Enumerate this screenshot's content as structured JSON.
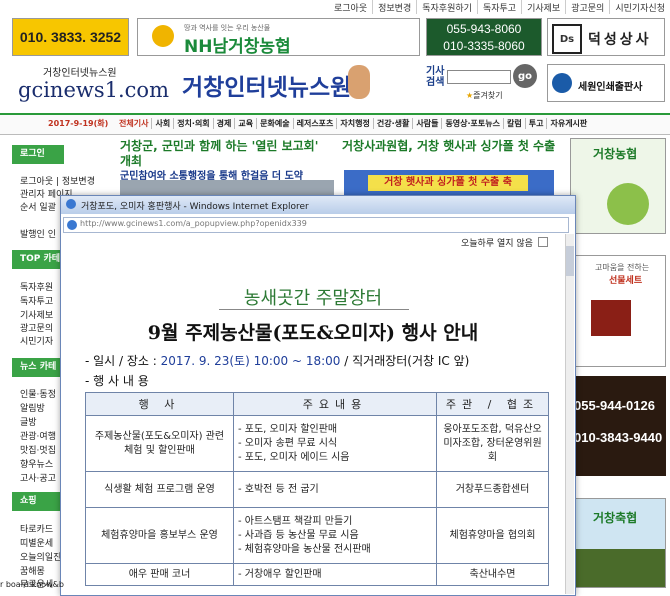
{
  "top_nav": [
    "로그아웃",
    "정보변경",
    "독자후원하기",
    "독자투고",
    "기사제보",
    "광고문의",
    "시민기자신청"
  ],
  "ads": {
    "phone_yellow": "010. 3833. 3252",
    "nh_slogan": "땅과 역사를 잇는 우리 농산물",
    "nh_name": "NH남거창농협",
    "phones_green": [
      "055-943-8060",
      "010-3335-8060"
    ],
    "ds_logo": "Ds",
    "ds_name": "덕성상사",
    "seweon": "세원인쇄출판사"
  },
  "site": {
    "small_name": "거창인터넷뉴스원",
    "domain": "gcinews1.com",
    "big_title": "거창인터넷뉴스원"
  },
  "search": {
    "label1": "기사",
    "label2": "검색",
    "go": "go",
    "favorites": "즐겨찾기"
  },
  "menu": {
    "date": "2017-9-19(화)",
    "items": [
      "전체기사",
      "사회",
      "정치·의회",
      "경제",
      "교육",
      "문화예술",
      "레저스포츠",
      "자치행정",
      "건강·생활",
      "사람들",
      "동영상·포토뉴스",
      "칼럼",
      "투고",
      "자유게시판"
    ]
  },
  "sidebar": {
    "login_head": "로그인",
    "login_items": [
      "로그아웃 | 정보변경",
      "관리자 페이지",
      "순서 일괄"
    ],
    "extra_item": "발행인 인",
    "top_head": "TOP 카테",
    "top_items": [
      "독자후원",
      "독자투고",
      "기사제보",
      "광고문의",
      "시민기자"
    ],
    "news_head": "뉴스 카테",
    "news_items": [
      "인물·동정",
      "알림방",
      "글방",
      "관광·여행",
      "맛집·멋집",
      "향우뉴스",
      "고사·공고"
    ],
    "shop_head": "쇼핑",
    "shop_items": [
      "타로카드",
      "띠별운세",
      "오늘의일진",
      "꿈해몽",
      "무료운세"
    ]
  },
  "articles": {
    "a1_title": "거창군, 군민과 함께 하는 '열린 보고회' 개최",
    "a1_sub": "군민참여와 소통행정을 통해 한걸음 더 도약",
    "a2_title": "거창사과원협, 거창 햇사과 싱가폴 첫 수출",
    "a2_banner": "거창 햇사과 싱가폴 첫 수출 축"
  },
  "right_ads": {
    "nonghyup": "거창농협",
    "gift1": "고마움을 전하는",
    "gift2": "선물세트",
    "phone1": "055-944-0126",
    "phone2": "010-3843-9440",
    "festival": "거창축협"
  },
  "popup": {
    "window_title": "거창포도, 오미자 홍판행사 - Windows Internet Explorer",
    "address": "http://www.gcinews1.com/a_popupview.php?openidx339",
    "no_show": "오늘하루 열지 않음",
    "heading1": "농새곳간 주말장터",
    "heading2": "9월 주제농산물(포도&오미자) 행사 안내",
    "line1_label": "- 일시 / 장소 : ",
    "line1_value": "2017. 9. 23(토) 10:00 ~ 18:00",
    "line1_place": " / 직거래장터(거창 IC 앞)",
    "line2": "- 행 사 내 용",
    "table_headers": [
      "행 사",
      "주요내용",
      "주관 / 협조"
    ],
    "rows": [
      {
        "event": "주제농산물(포도&오미자) 관련 체험 및 할인판매",
        "content": "- 포도, 오미자 할인판매\n- 오미자 송편 무료 시식\n- 포도, 오미자 에이드 시음",
        "org": "웅아포도조합, 덕유산오미자조합, 장터운영위원회"
      },
      {
        "event": "식생활 체험 프로그램 운영",
        "content": "- 호박전 등 전 굽기",
        "org": "거창푸드종합센터"
      },
      {
        "event": "체험휴양마을 홍보부스 운영",
        "content": "- 아트스탬프 책갈피 만들기\n- 사과즙 등 농산물 무료 시음\n- 체험휴양마을 농산물 전시판매",
        "org": "체험휴양마을 협의회"
      },
      {
        "event": "애우 판매 코너",
        "content": "- 거창애우 할인판매",
        "org": "축산내수면"
      }
    ],
    "window_buttons": {
      "min": "_",
      "max": "□",
      "close": "X"
    }
  },
  "status_text": "r board know&b"
}
